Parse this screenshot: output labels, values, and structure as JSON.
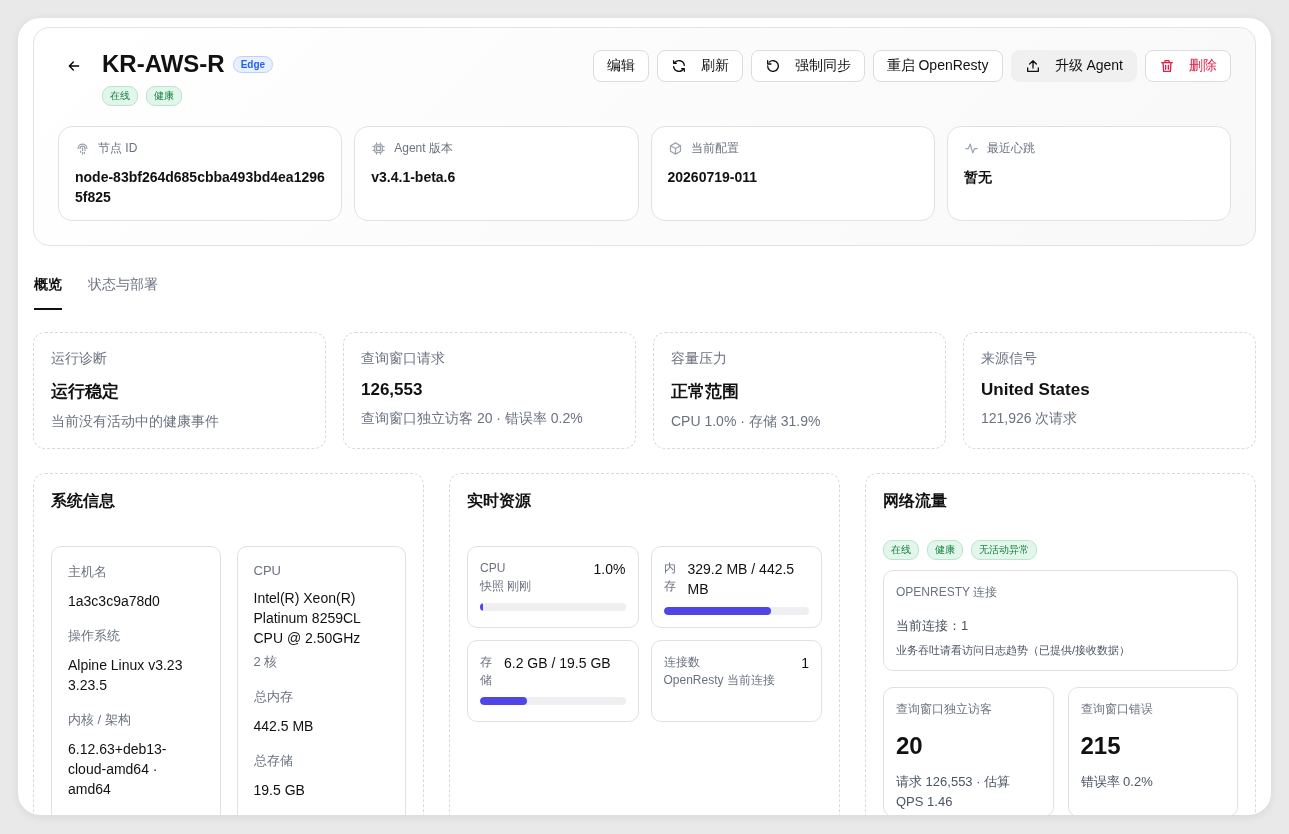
{
  "header": {
    "title": "KR-AWS-R",
    "type_badge": "Edge",
    "status_badges": [
      "在线",
      "健康"
    ],
    "buttons": [
      {
        "label": "编辑",
        "kind": "plain"
      },
      {
        "label": "刷新",
        "kind": "refresh"
      },
      {
        "label": "强制同步",
        "kind": "sync"
      },
      {
        "label": "重启 OpenResty",
        "kind": "plain"
      },
      {
        "label": "升级 Agent",
        "kind": "upload"
      },
      {
        "label": "删除",
        "kind": "danger"
      }
    ],
    "info_cards": [
      {
        "label": "节点 ID",
        "value": "node-83bf264d685cbba493bd4ea12965f825",
        "kind": "fingerprint"
      },
      {
        "label": "Agent 版本",
        "value": "v3.4.1-beta.6",
        "kind": "chip"
      },
      {
        "label": "当前配置",
        "value": "20260719-011",
        "kind": "package"
      },
      {
        "label": "最近心跳",
        "value": "暂无",
        "kind": "pulse"
      }
    ]
  },
  "tabs": [
    {
      "label": "概览",
      "selected": true
    },
    {
      "label": "状态与部署",
      "selected": false
    }
  ],
  "summary_cards": [
    {
      "label": "运行诊断",
      "value": "运行稳定",
      "note": "当前没有活动中的健康事件"
    },
    {
      "label": "查询窗口请求",
      "value": "126,553",
      "note": "查询窗口独立访客 20 · 错误率 0.2%"
    },
    {
      "label": "容量压力",
      "value": "正常范围",
      "note": "CPU 1.0% · 存储 31.9%"
    },
    {
      "label": "来源信号",
      "value": "United States",
      "note": "121,926 次请求"
    }
  ],
  "system_info": {
    "title": "系统信息",
    "columns": [
      [
        {
          "label": "主机名",
          "value": "1a3c3c9a78d0"
        },
        {
          "label": "操作系统",
          "value": "Alpine Linux v3.23 3.23.5"
        },
        {
          "label": "内核 / 架构",
          "value": "6.12.63+deb13-cloud-amd64 · amd64"
        }
      ],
      [
        {
          "label": "CPU",
          "value": "Intel(R) Xeon(R) Platinum 8259CL CPU @ 2.50GHz",
          "note": "2 核"
        },
        {
          "label": "总内存",
          "value": "442.5 MB"
        },
        {
          "label": "总存储",
          "value": "19.5 GB"
        }
      ]
    ]
  },
  "realtime": {
    "title": "实时资源",
    "metrics": [
      {
        "label": "CPU",
        "value": "1.0%",
        "note": "快照 刚刚",
        "level": 0.01,
        "kind": "bar"
      },
      {
        "label": "内存",
        "value": "329.2 MB / 442.5 MB",
        "level": 0.74,
        "kind": "bar"
      },
      {
        "label": "存储",
        "value": "6.2 GB / 19.5 GB",
        "level": 0.32,
        "kind": "bar"
      },
      {
        "label": "连接数",
        "value": "1",
        "note": "OpenResty 当前连接",
        "kind": "count"
      }
    ]
  },
  "network": {
    "title": "网络流量",
    "badges": [
      "在线",
      "健康",
      "无活动异常"
    ],
    "connection": {
      "title": "OPENRESTY 连接",
      "value": "当前连接：1",
      "note": "业务吞吐请看访问日志趋势（已提供/接收数据）"
    },
    "stats": [
      {
        "label": "查询窗口独立访客",
        "value": "20",
        "note": "请求 126,553 · 估算 QPS 1.46"
      },
      {
        "label": "查询窗口错误",
        "value": "215",
        "note": "错误率 0.2%"
      }
    ]
  }
}
